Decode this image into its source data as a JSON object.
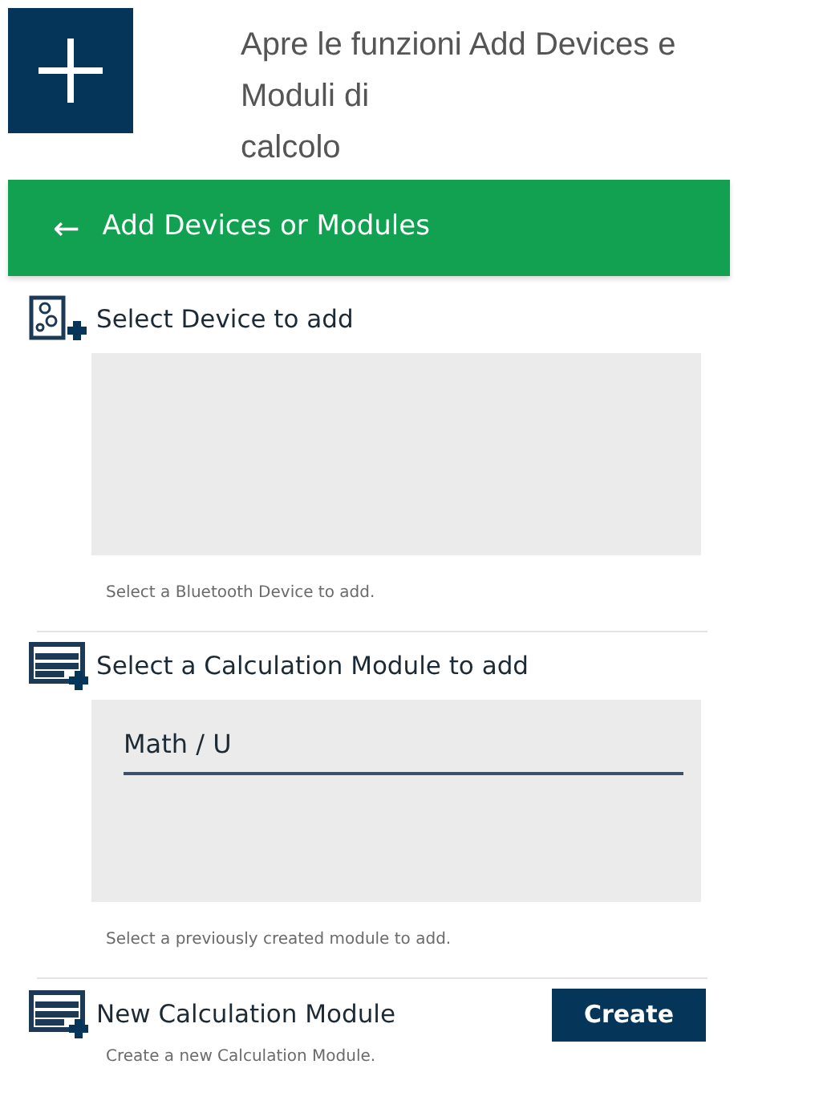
{
  "caption": {
    "lines": [
      "Apre le funzioni Add Devices e",
      "Moduli di",
      "calcolo"
    ]
  },
  "app_bar": {
    "back": "←",
    "title": "Add Devices or Modules"
  },
  "sections": [
    {
      "kind": "list",
      "title": "Select Device to add",
      "hint": "Select a Bluetooth Device to add."
    },
    {
      "kind": "list",
      "title": "Select a Calculation Module to add",
      "items": [
        {
          "label": "Math / U"
        }
      ],
      "hint": "Select a previously created module to add."
    },
    {
      "kind": "create",
      "title": "New Calculation Module",
      "button": "Create",
      "hint": "Create a new Calculation Module."
    }
  ]
}
